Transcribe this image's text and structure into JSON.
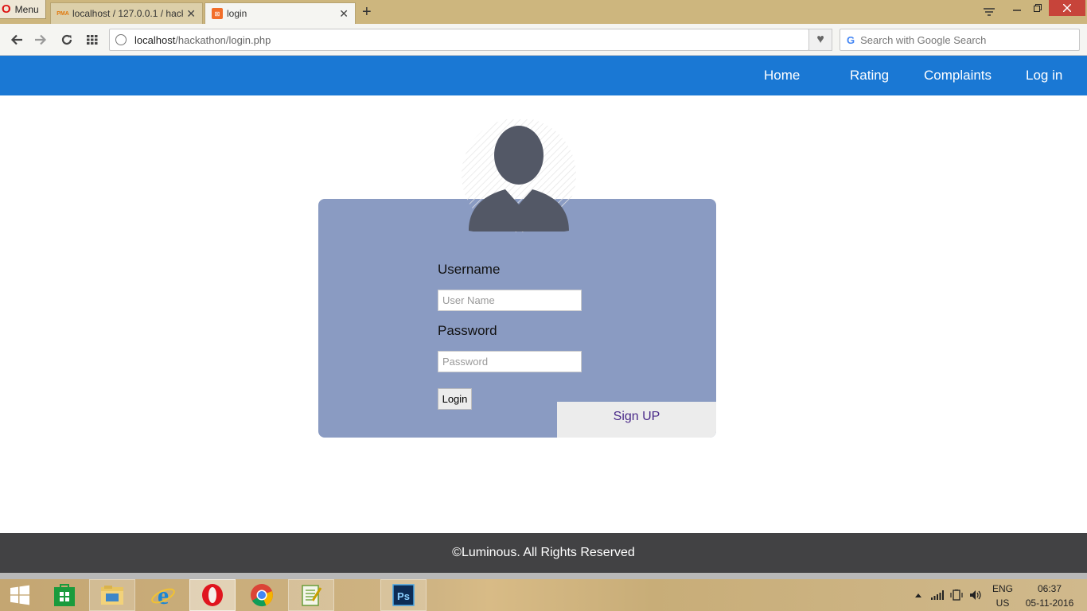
{
  "browser": {
    "menu_label": "Menu",
    "tabs": [
      {
        "favicon": "PMA",
        "title": "localhost / 127.0.0.1 / hack",
        "close": "✕"
      },
      {
        "favicon": "xampp-icon",
        "title": "login",
        "close": "✕"
      }
    ],
    "new_tab": "+",
    "url_host": "localhost",
    "url_path": "/hackathon/login.php",
    "search_placeholder": "Search with Google Search",
    "search_g": "G"
  },
  "nav": {
    "links": [
      "Home",
      "Rating",
      "Complaints",
      "Log in"
    ]
  },
  "login": {
    "username_label": "Username",
    "username_placeholder": "User Name",
    "password_label": "Password",
    "password_placeholder": "Password",
    "login_button": "Login",
    "signup_label": "Sign UP"
  },
  "footer": {
    "text": "©Luminous. All Rights Reserved"
  },
  "taskbar": {
    "lang_top": "ENG",
    "lang_bottom": "US",
    "time": "06:37",
    "date": "05-11-2016"
  },
  "colors": {
    "nav_bg": "#1a78d4",
    "card_bg": "#8a9bc2",
    "footer_bg": "#424244",
    "signup_text": "#4b2b8a"
  }
}
